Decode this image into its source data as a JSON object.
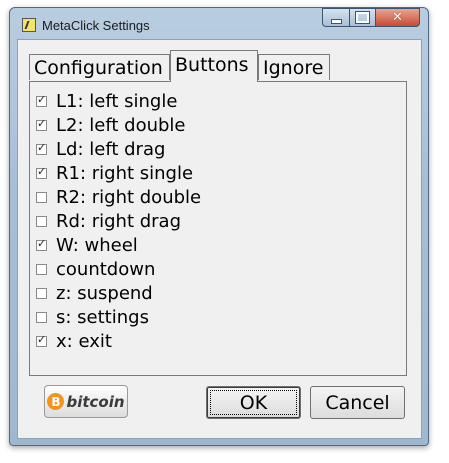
{
  "window": {
    "title": "MetaClick Settings",
    "icon": "metaclick-app-icon",
    "close_glyph": "✕"
  },
  "tabs": [
    {
      "label": "Configuration",
      "selected": false
    },
    {
      "label": "Buttons",
      "selected": true
    },
    {
      "label": "Ignore",
      "selected": false
    }
  ],
  "options": [
    {
      "label": "L1: left single",
      "checked": true
    },
    {
      "label": "L2: left double",
      "checked": true
    },
    {
      "label": "Ld: left drag",
      "checked": true
    },
    {
      "label": "R1: right single",
      "checked": true
    },
    {
      "label": "R2: right double",
      "checked": false
    },
    {
      "label": "Rd: right drag",
      "checked": false
    },
    {
      "label": "W: wheel",
      "checked": true
    },
    {
      "label": "countdown",
      "checked": false
    },
    {
      "label": "z: suspend",
      "checked": false
    },
    {
      "label": "s: settings",
      "checked": false
    },
    {
      "label": "x: exit",
      "checked": true
    }
  ],
  "buttons": {
    "bitcoin_symbol": "B",
    "bitcoin_label": "bitcoin",
    "ok": "OK",
    "cancel": "Cancel"
  },
  "colors": {
    "bitcoin_orange": "#f7931a",
    "close_red": "#c74a33"
  }
}
